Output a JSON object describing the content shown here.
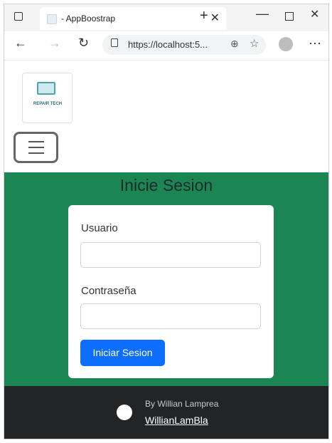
{
  "browser": {
    "tab_title": "- AppBoostrap",
    "url": "https://localhost:5..."
  },
  "icons": {
    "window_menu": "square-icon",
    "tab_favicon": "page-icon",
    "tab_close": "close-icon",
    "new_tab": "plus-icon",
    "minimize": "minimize-icon",
    "maximize": "maximize-icon",
    "close": "close-icon",
    "back": "back-arrow-icon",
    "forward": "forward-arrow-icon",
    "refresh": "refresh-icon",
    "lock": "lock-icon",
    "zoom": "zoom-icon",
    "favorites": "star-icon",
    "profile": "user-avatar-icon",
    "more": "more-icon",
    "hamburger": "hamburger-icon",
    "github": "github-icon"
  },
  "brand": {
    "logo_text": "REPAIR TECH"
  },
  "page": {
    "title": "Inicie Sesion",
    "username_label": "Usuario",
    "password_label": "Contraseña",
    "submit_label": "Iniciar Sesion"
  },
  "footer": {
    "by_text": "By Willian Lamprea",
    "link_text": "WillianLamBla"
  },
  "colors": {
    "green_background": "#1b8554",
    "primary_button": "#0d6efd",
    "footer_background": "#222426"
  }
}
